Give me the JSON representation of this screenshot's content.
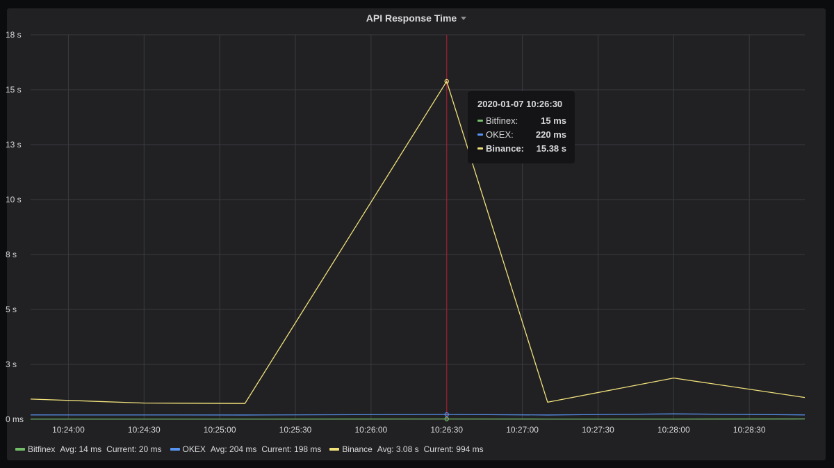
{
  "panel": {
    "title": "API Response Time"
  },
  "chart_data": {
    "type": "line",
    "title": "API Response Time",
    "x_ticks": [
      "10:24:00",
      "10:24:30",
      "10:25:00",
      "10:25:30",
      "10:26:00",
      "10:26:30",
      "10:27:00",
      "10:27:30",
      "10:28:00",
      "10:28:30"
    ],
    "y_ticks": [
      "0 ms",
      "3 s",
      "5 s",
      "8 s",
      "10 s",
      "13 s",
      "15 s",
      "18 s"
    ],
    "y_tick_values_s": [
      0,
      2.5,
      5,
      7.5,
      10,
      12.5,
      15,
      17.5
    ],
    "ylim_s": [
      0,
      17.5
    ],
    "x_range": [
      "10:23:45",
      "10:28:52"
    ],
    "series": [
      {
        "name": "Bitfinex",
        "color": "#73bf69",
        "points": [
          [
            "10:23:45",
            0.014
          ],
          [
            "10:25:10",
            0.014
          ],
          [
            "10:26:30",
            0.015
          ],
          [
            "10:27:10",
            0.014
          ],
          [
            "10:28:00",
            0.014
          ],
          [
            "10:28:52",
            0.02
          ]
        ]
      },
      {
        "name": "OKEX",
        "color": "#5794f2",
        "points": [
          [
            "10:23:45",
            0.2
          ],
          [
            "10:25:10",
            0.195
          ],
          [
            "10:26:30",
            0.22
          ],
          [
            "10:27:10",
            0.195
          ],
          [
            "10:28:00",
            0.25
          ],
          [
            "10:28:52",
            0.198
          ]
        ]
      },
      {
        "name": "Binance",
        "color": "#f2e27a",
        "points": [
          [
            "10:23:45",
            0.92
          ],
          [
            "10:24:30",
            0.74
          ],
          [
            "10:25:10",
            0.72
          ],
          [
            "10:26:30",
            15.38
          ],
          [
            "10:27:10",
            0.78
          ],
          [
            "10:28:00",
            1.88
          ],
          [
            "10:28:52",
            0.994
          ]
        ]
      }
    ],
    "crosshair_time": "10:26:30",
    "grid": true,
    "legend_position": "bottom"
  },
  "tooltip": {
    "time": "2020-01-07 10:26:30",
    "rows": [
      {
        "name": "Bitfinex:",
        "value": "15 ms",
        "color": "#73bf69"
      },
      {
        "name": "OKEX:",
        "value": "220 ms",
        "color": "#5794f2"
      },
      {
        "name": "Binance:",
        "value": "15.38 s",
        "color": "#f2e27a"
      }
    ]
  },
  "legend": [
    {
      "name": "Bitfinex",
      "avg": "Avg: 14 ms",
      "current": "Current: 20 ms",
      "color": "#73bf69"
    },
    {
      "name": "OKEX",
      "avg": "Avg: 204 ms",
      "current": "Current: 198 ms",
      "color": "#5794f2"
    },
    {
      "name": "Binance",
      "avg": "Avg: 3.08 s",
      "current": "Current: 994 ms",
      "color": "#f2e27a"
    }
  ]
}
